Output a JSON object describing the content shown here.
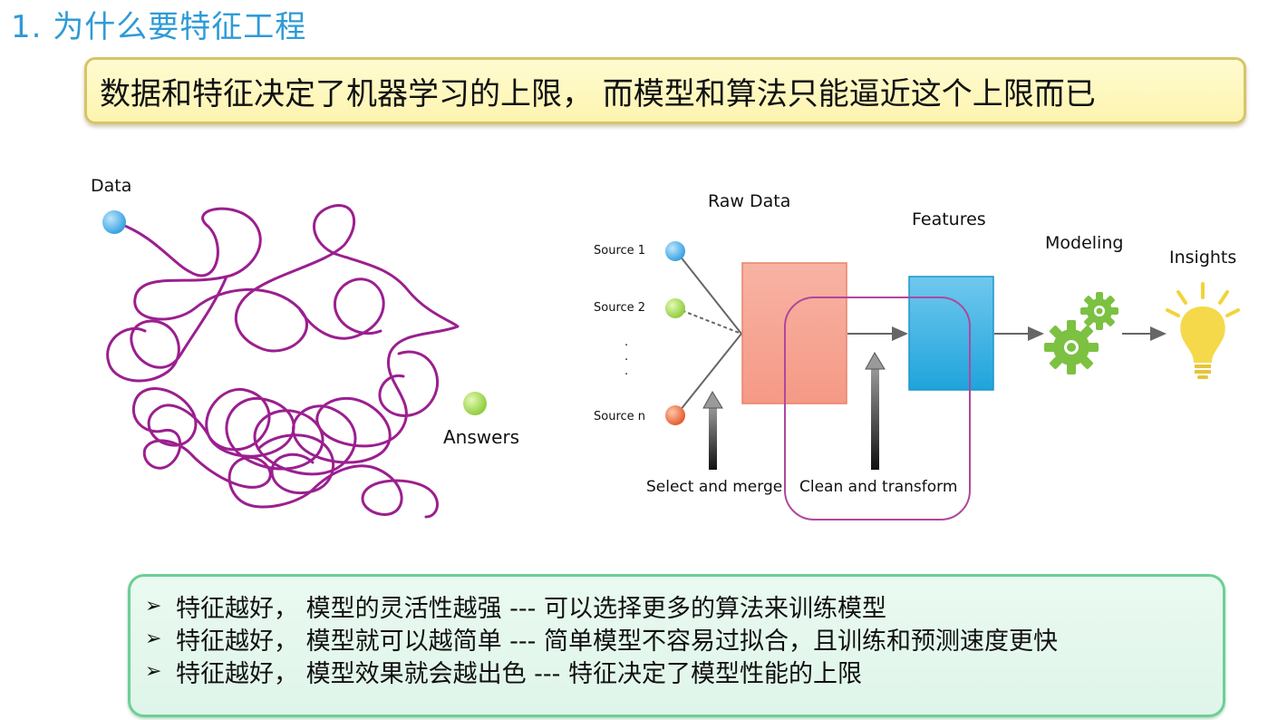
{
  "title": "1. 为什么要特征工程",
  "headline": "数据和特征决定了机器学习的上限，  而模型和算法只能逼近这个上限而已",
  "left_diagram": {
    "start_label": "Data",
    "end_label": "Answers",
    "start_color": "#49aee8",
    "end_color": "#9bd84a",
    "path_color": "#9b1f8f"
  },
  "pipeline": {
    "raw_data_label": "Raw Data",
    "features_label": "Features",
    "modeling_label": "Modeling",
    "insights_label": "Insights",
    "sources": [
      "Source 1",
      "Source 2",
      "Source n"
    ],
    "ellipsis": ".\n.\n.",
    "select_merge_label": "Select and merge",
    "clean_transform_label": "Clean and transform",
    "colors": {
      "source1": "#49aee8",
      "source2": "#9bd84a",
      "sourcen": "#e8643a",
      "raw_box": "#f7a493",
      "features_box": "#3fb3e3",
      "gear": "#7cc142",
      "bulb": "#f3d33a",
      "highlight": "#b0479e"
    }
  },
  "bullets": {
    "marker": "➢",
    "items": [
      "特征越好，  模型的灵活性越强 --- 可以选择更多的算法来训练模型",
      "特征越好，  模型就可以越简单 --- 简单模型不容易过拟合，且训练和预测速度更快",
      "特征越好，  模型效果就会越出色 --- 特征决定了模型性能的上限"
    ]
  }
}
